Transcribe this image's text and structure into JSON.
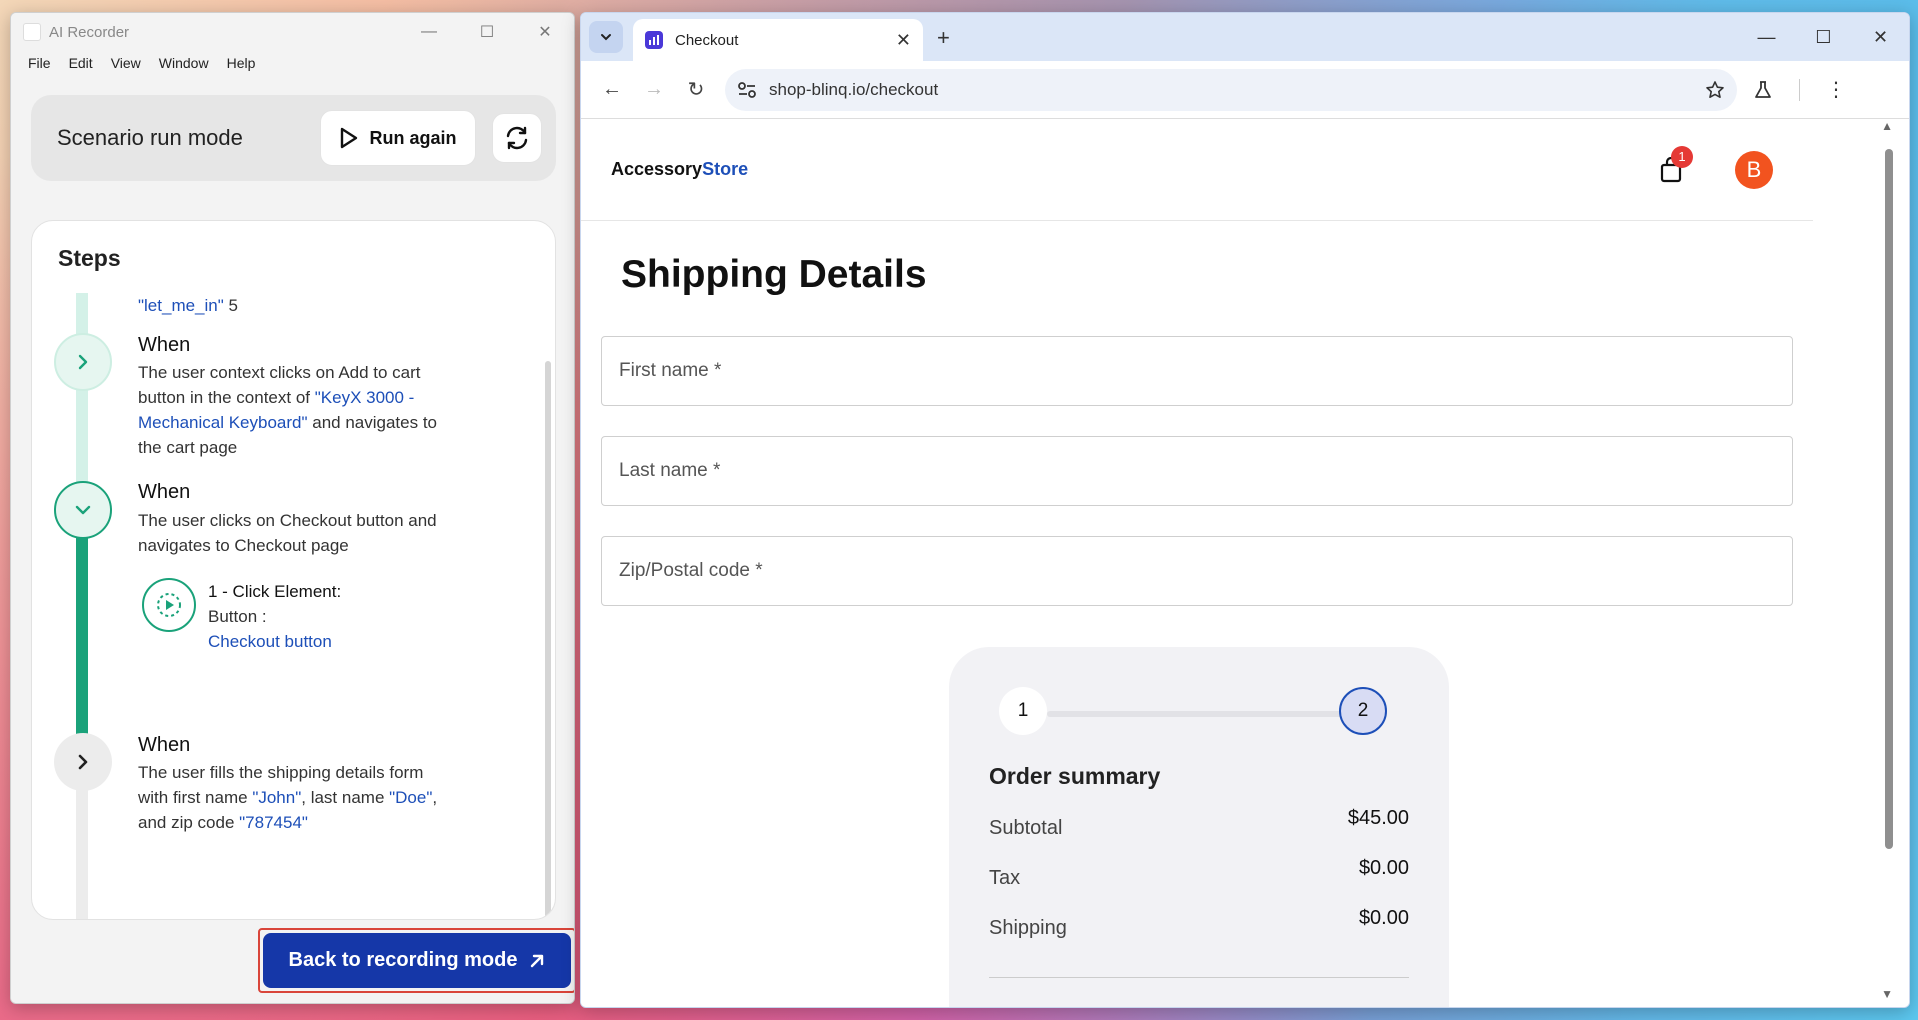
{
  "recorder": {
    "title": "AI Recorder",
    "menu": [
      "File",
      "Edit",
      "View",
      "Window",
      "Help"
    ],
    "scenario_label": "Scenario run mode",
    "run_again_label": "Run again",
    "steps_title": "Steps",
    "steps": [
      {
        "fragment_link": "\"let_me_in\"",
        "fragment_rest": " 5"
      },
      {
        "keyword": "When",
        "text_a": "The user context clicks on Add to cart button in the context of ",
        "link": "\"KeyX 3000 - Mechanical Keyboard\"",
        "text_b": " and navigates to the cart page"
      },
      {
        "keyword": "When",
        "text_a": "The user clicks on Checkout button and navigates to Checkout page",
        "sub_title": "1 - Click Element:",
        "sub_type": "Button :",
        "sub_link": "Checkout button"
      },
      {
        "keyword": "When",
        "text_a": "The user fills the shipping details form with first name ",
        "link1": "\"John\"",
        "text_b": ", last name ",
        "link2": "\"Doe\"",
        "text_c": ", and zip code ",
        "link3": "\"787454\""
      }
    ],
    "back_button_label": "Back to recording mode"
  },
  "browser": {
    "tab_title": "Checkout",
    "url": "shop-blinq.io/checkout"
  },
  "store": {
    "logo_a": "Accessory",
    "logo_b": "Store",
    "cart_count": "1",
    "avatar_letter": "B",
    "page_title": "Shipping Details",
    "fields": {
      "first_name": "First name *",
      "last_name": "Last name *",
      "zip": "Zip/Postal code *"
    },
    "stepper": [
      "1",
      "2"
    ],
    "summary_title": "Order summary",
    "summary_rows": [
      {
        "label": "Subtotal",
        "value": "$45.00"
      },
      {
        "label": "Tax",
        "value": "$0.00"
      },
      {
        "label": "Shipping",
        "value": "$0.00"
      }
    ]
  },
  "colors": {
    "accent_green": "#1aa27a",
    "primary_blue": "#1537a8",
    "link_blue": "#1d4fb8",
    "badge_red": "#e53935",
    "avatar_orange": "#f2531f"
  }
}
